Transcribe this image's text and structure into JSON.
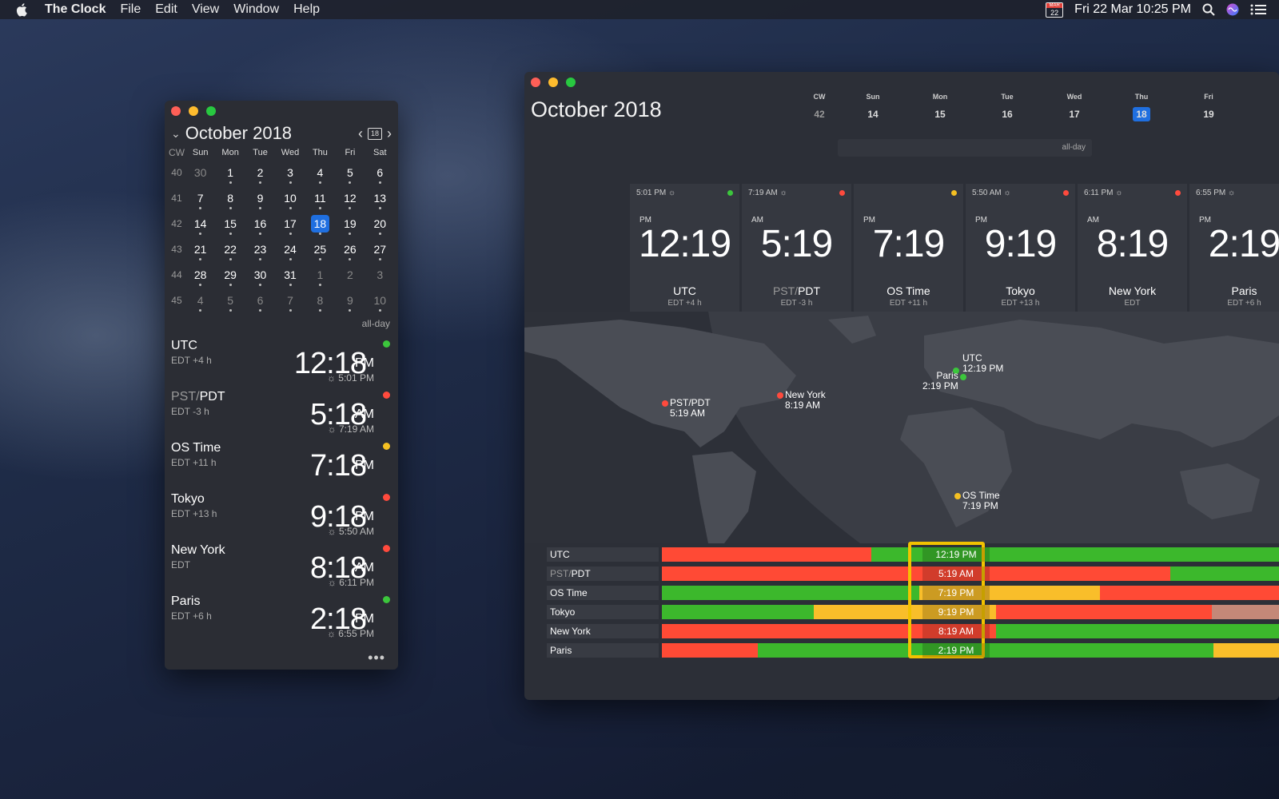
{
  "menubar": {
    "app_name": "The Clock",
    "menus": [
      "File",
      "Edit",
      "View",
      "Window",
      "Help"
    ],
    "calendar_icon_month": "MAR",
    "calendar_icon_day": "22",
    "clock": "Fri 22 Mar  10:25 PM"
  },
  "sidebar_window": {
    "month_title": "October 2018",
    "calendar_icon_day": "18",
    "weekday_headers": [
      "CW",
      "Sun",
      "Mon",
      "Tue",
      "Wed",
      "Thu",
      "Fri",
      "Sat"
    ],
    "weeks": [
      {
        "cw": "40",
        "days": [
          "30",
          "1",
          "2",
          "3",
          "4",
          "5",
          "6"
        ]
      },
      {
        "cw": "41",
        "days": [
          "7",
          "8",
          "9",
          "10",
          "11",
          "12",
          "13"
        ]
      },
      {
        "cw": "42",
        "days": [
          "14",
          "15",
          "16",
          "17",
          "18",
          "19",
          "20"
        ]
      },
      {
        "cw": "43",
        "days": [
          "21",
          "22",
          "23",
          "24",
          "25",
          "26",
          "27"
        ]
      },
      {
        "cw": "44",
        "days": [
          "28",
          "29",
          "30",
          "31",
          "1",
          "2",
          "3"
        ]
      },
      {
        "cw": "45",
        "days": [
          "4",
          "5",
          "6",
          "7",
          "8",
          "9",
          "10"
        ]
      }
    ],
    "selected_day": "18",
    "all_day_label": "all-day",
    "zones": [
      {
        "name": "UTC",
        "name_dim": "",
        "offset": "EDT +4 h",
        "time": "12:18",
        "ampm": "PM",
        "sunset": "5:01 PM",
        "status_color": "#3cc63c"
      },
      {
        "name": "PDT",
        "name_dim": "PST/",
        "offset": "EDT -3 h",
        "time": "5:18",
        "ampm": "AM",
        "sunset": "7:19 AM",
        "status_color": "#ff4a3d"
      },
      {
        "name": "OS Time",
        "name_dim": "",
        "offset": "EDT +11 h",
        "time": "7:18",
        "ampm": "PM",
        "sunset": "",
        "status_color": "#f5c022"
      },
      {
        "name": "Tokyo",
        "name_dim": "",
        "offset": "EDT +13 h",
        "time": "9:18",
        "ampm": "PM",
        "sunset": "5:50 AM",
        "status_color": "#ff4a3d"
      },
      {
        "name": "New York",
        "name_dim": "",
        "offset": "EDT",
        "time": "8:18",
        "ampm": "AM",
        "sunset": "6:11 PM",
        "status_color": "#ff4a3d"
      },
      {
        "name": "Paris",
        "name_dim": "",
        "offset": "EDT +6 h",
        "time": "2:18",
        "ampm": "PM",
        "sunset": "6:55 PM",
        "status_color": "#3cc63c"
      }
    ]
  },
  "main_window": {
    "month_title": "October 2018",
    "cw_label": "CW",
    "cw_value": "42",
    "week": [
      {
        "day": "Sun",
        "date": "14"
      },
      {
        "day": "Mon",
        "date": "15"
      },
      {
        "day": "Tue",
        "date": "16"
      },
      {
        "day": "Wed",
        "date": "17"
      },
      {
        "day": "Thu",
        "date": "18"
      },
      {
        "day": "Fri",
        "date": "19"
      }
    ],
    "selected_date": "18",
    "all_day_label": "all-day",
    "cards": [
      {
        "sun": "5:01 PM",
        "ampm": "PM",
        "time": "12:19",
        "name": "UTC",
        "name_dim": "",
        "offset": "EDT +4 h",
        "status_color": "#3cc63c"
      },
      {
        "sun": "7:19 AM",
        "ampm": "AM",
        "time": "5:19",
        "name": "PDT",
        "name_dim": "PST/",
        "offset": "EDT -3 h",
        "status_color": "#ff4a3d"
      },
      {
        "sun": "",
        "ampm": "PM",
        "time": "7:19",
        "name": "OS Time",
        "name_dim": "",
        "offset": "EDT +11 h",
        "status_color": "#f5c022"
      },
      {
        "sun": "5:50 AM",
        "ampm": "PM",
        "time": "9:19",
        "name": "Tokyo",
        "name_dim": "",
        "offset": "EDT +13 h",
        "status_color": "#ff4a3d"
      },
      {
        "sun": "6:11 PM",
        "ampm": "AM",
        "time": "8:19",
        "name": "New York",
        "name_dim": "",
        "offset": "EDT",
        "status_color": "#ff4a3d"
      },
      {
        "sun": "6:55 PM",
        "ampm": "PM",
        "time": "2:19",
        "name": "Paris",
        "name_dim": "",
        "offset": "EDT +6 h",
        "status_color": ""
      }
    ],
    "map_pins": [
      {
        "name": "UTC",
        "time": "12:19 PM",
        "color": "#3cc63c"
      },
      {
        "name": "Paris",
        "time": "2:19 PM",
        "color": "#3cc63c"
      },
      {
        "name": "PST/PDT",
        "time": "5:19 AM",
        "color": "#ff4a3d"
      },
      {
        "name": "New York",
        "time": "8:19 AM",
        "color": "#ff4a3d"
      },
      {
        "name": "OS Time",
        "time": "7:19 PM",
        "color": "#f5c022"
      }
    ],
    "timeline": [
      {
        "name": "UTC",
        "name_dim": "",
        "selected_time": "12:19 PM"
      },
      {
        "name": "PDT",
        "name_dim": "PST/",
        "selected_time": "5:19 AM"
      },
      {
        "name": "OS Time",
        "name_dim": "",
        "selected_time": "7:19 PM"
      },
      {
        "name": "Tokyo",
        "name_dim": "",
        "selected_time": "9:19 PM"
      },
      {
        "name": "New York",
        "name_dim": "",
        "selected_time": "8:19 AM"
      },
      {
        "name": "Paris",
        "name_dim": "",
        "selected_time": "2:19 PM"
      }
    ]
  },
  "colors": {
    "green": "#3cc63c",
    "red": "#ff4a3d",
    "yellow": "#f5c022",
    "accent_blue": "#1f6fe0",
    "selection": "#f2c200"
  }
}
